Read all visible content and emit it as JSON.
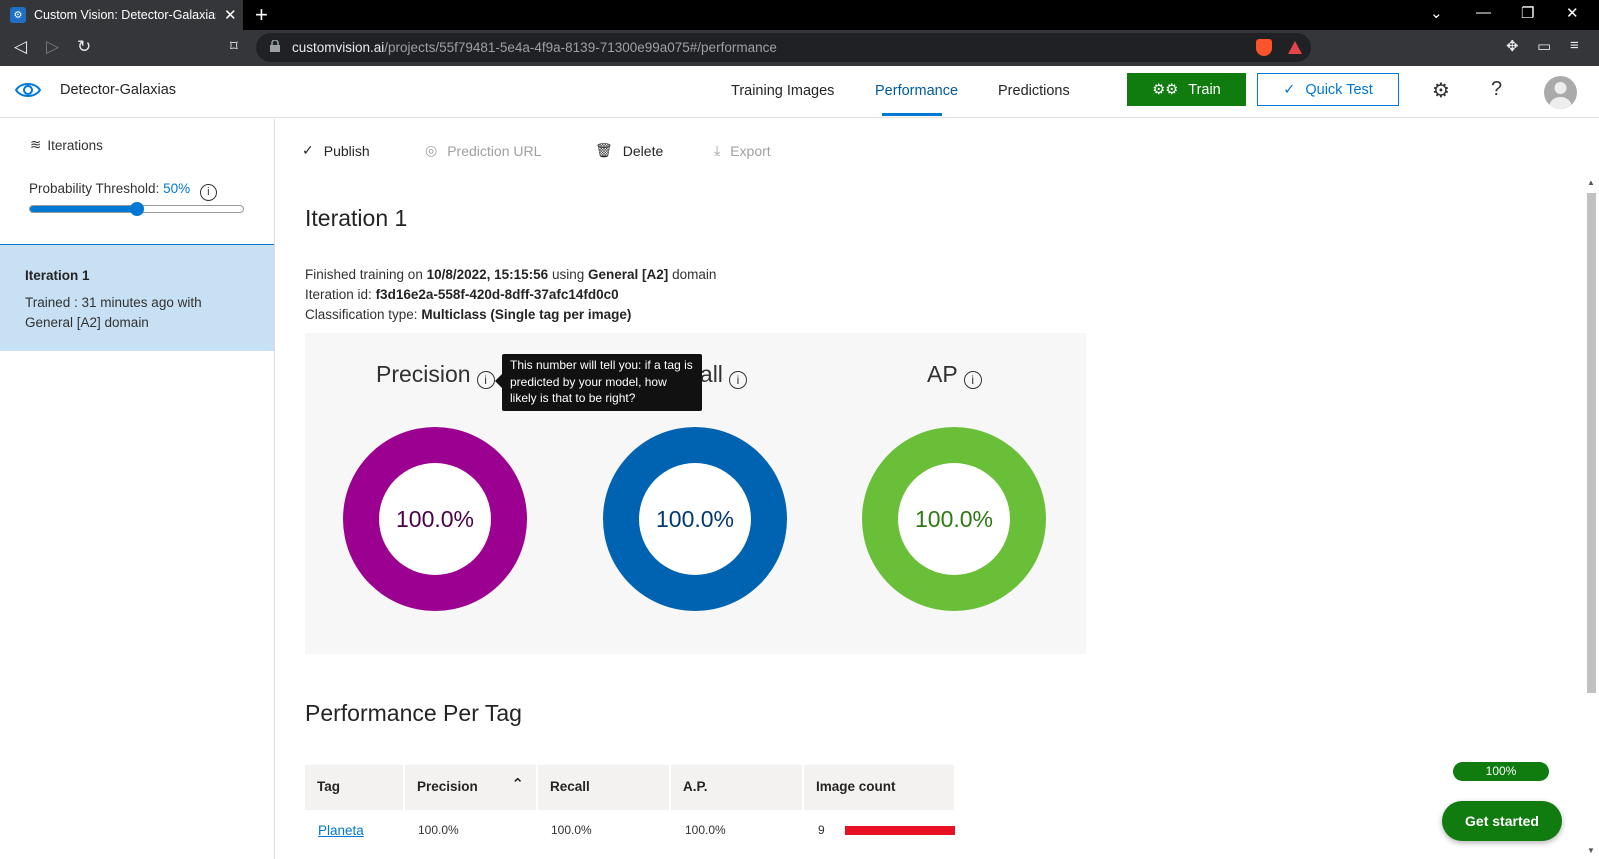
{
  "browser": {
    "tab_title": "Custom Vision: Detector-Galaxias",
    "url_host": "customvision.ai",
    "url_path": "/projects/55f79481-5e4a-4f9a-8139-71300e99a075#/performance"
  },
  "header": {
    "project_name": "Detector-Galaxias",
    "tabs": [
      "Training Images",
      "Performance",
      "Predictions"
    ],
    "active_tab": "Performance",
    "train_label": "Train",
    "quick_test_label": "Quick Test"
  },
  "sidebar": {
    "iterations_label": "Iterations",
    "threshold_label": "Probability Threshold:",
    "threshold_value": "50%",
    "threshold_fraction": 0.5,
    "iteration": {
      "title": "Iteration 1",
      "desc": "Trained : 31 minutes ago with General [A2] domain"
    }
  },
  "toolbar": {
    "publish": "Publish",
    "prediction_url": "Prediction URL",
    "delete": "Delete",
    "export": "Export"
  },
  "main": {
    "heading": "Iteration 1",
    "finished_prefix": "Finished training on",
    "finished_date": "10/8/2022, 15:15:56",
    "using": "using",
    "domain_name": "General [A2]",
    "domain_suffix": "domain",
    "iteration_id_label": "Iteration id:",
    "iteration_id": "f3d16e2a-558f-420d-8dff-37afc14fd0c0",
    "classification_label": "Classification type:",
    "classification": "Multiclass (Single tag per image)"
  },
  "metrics": [
    {
      "name": "Precision",
      "value": "100.0%",
      "color": "#9b0091"
    },
    {
      "name": "Recall",
      "value": "100.0%",
      "color": "#0063b1"
    },
    {
      "name": "AP",
      "value": "100.0%",
      "color": "#6abf39"
    }
  ],
  "tooltip": "This number will tell you: if a tag is predicted by your model, how likely is that to be right?",
  "per_tag": {
    "heading": "Performance Per Tag",
    "columns": [
      "Tag",
      "Precision",
      "Recall",
      "A.P.",
      "Image count"
    ],
    "rows": [
      {
        "tag": "Planeta",
        "precision": "100.0%",
        "recall": "100.0%",
        "ap": "100.0%",
        "count": "9"
      }
    ]
  },
  "widget": {
    "progress": "100%",
    "get_started": "Get started"
  }
}
